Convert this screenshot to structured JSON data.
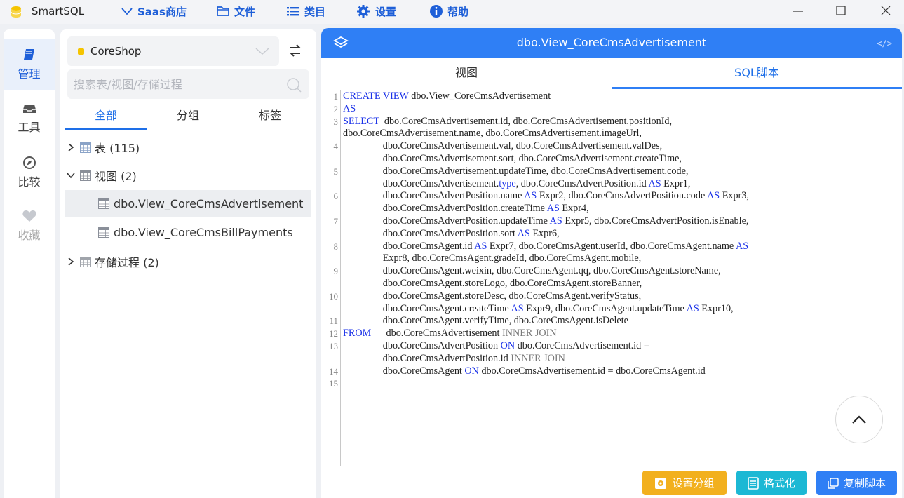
{
  "app": {
    "title": "SmartSQL"
  },
  "menu": [
    {
      "label": "Saas商店",
      "icon": "chevron-down-icon"
    },
    {
      "label": "文件",
      "icon": "folder-icon"
    },
    {
      "label": "类目",
      "icon": "list-icon"
    },
    {
      "label": "设置",
      "icon": "gear-icon"
    },
    {
      "label": "帮助",
      "icon": "info-icon"
    }
  ],
  "rail": [
    {
      "label": "管理",
      "icon": "book-icon",
      "active": true
    },
    {
      "label": "工具",
      "icon": "inbox-icon"
    },
    {
      "label": "比较",
      "icon": "compass-icon"
    },
    {
      "label": "收藏",
      "icon": "heart-icon"
    }
  ],
  "db": {
    "name": "CoreShop"
  },
  "search": {
    "placeholder": "搜索表/视图/存储过程"
  },
  "tree_tabs": [
    "全部",
    "分组",
    "标签"
  ],
  "tree": {
    "tables": "表 (115)",
    "views": "视图 (2)",
    "view_items": [
      "dbo.View_CoreCmsAdvertisement",
      "dbo.View_CoreCmsBillPayments"
    ],
    "procs": "存储过程 (2)"
  },
  "editor": {
    "title": "dbo.View_CoreCmsAdvertisement",
    "code_toggle": "</>",
    "tabs": [
      "视图",
      "SQL脚本"
    ],
    "active_tab": "SQL脚本",
    "lines": [
      {
        "n": "1",
        "t": [
          [
            "kw",
            "CREATE VIEW"
          ],
          [
            "",
            "dbo.View_CoreCmsAdvertisement"
          ]
        ]
      },
      {
        "n": "2",
        "t": [
          [
            "kw",
            "AS"
          ]
        ]
      },
      {
        "n": "3",
        "t": [
          [
            "kw",
            "SELECT"
          ],
          [
            "",
            "  dbo.CoreCmsAdvertisement.id, dbo.CoreCmsAdvertisement.positionId,"
          ]
        ]
      },
      {
        "n": "",
        "t": [
          [
            "",
            "dbo.CoreCmsAdvertisement.name, dbo.CoreCmsAdvertisement.imageUrl,"
          ]
        ]
      },
      {
        "n": "4",
        "t": [
          [
            "",
            "                dbo.CoreCmsAdvertisement.val, dbo.CoreCmsAdvertisement.valDes,"
          ]
        ]
      },
      {
        "n": "",
        "t": [
          [
            "",
            "                dbo.CoreCmsAdvertisement.sort, dbo.CoreCmsAdvertisement.createTime,"
          ]
        ]
      },
      {
        "n": "5",
        "t": [
          [
            "",
            "                dbo.CoreCmsAdvertisement.updateTime, dbo.CoreCmsAdvertisement.code,"
          ]
        ]
      },
      {
        "n": "",
        "t": [
          [
            "",
            "                dbo.CoreCmsAdvertisement."
          ],
          [
            "kw",
            "type"
          ],
          [
            "",
            ", dbo.CoreCmsAdvertPosition.id "
          ],
          [
            "kw",
            "AS"
          ],
          [
            "",
            " Expr1,"
          ]
        ]
      },
      {
        "n": "6",
        "t": [
          [
            "",
            "                dbo.CoreCmsAdvertPosition.name "
          ],
          [
            "kw",
            "AS"
          ],
          [
            "",
            " Expr2, dbo.CoreCmsAdvertPosition.code "
          ],
          [
            "kw",
            "AS"
          ],
          [
            "",
            " Expr3,"
          ]
        ]
      },
      {
        "n": "",
        "t": [
          [
            "",
            "                dbo.CoreCmsAdvertPosition.createTime "
          ],
          [
            "kw",
            "AS"
          ],
          [
            "",
            " Expr4,"
          ]
        ]
      },
      {
        "n": "7",
        "t": [
          [
            "",
            "                dbo.CoreCmsAdvertPosition.updateTime "
          ],
          [
            "kw",
            "AS"
          ],
          [
            "",
            " Expr5, dbo.CoreCmsAdvertPosition.isEnable,"
          ]
        ]
      },
      {
        "n": "",
        "t": [
          [
            "",
            "                dbo.CoreCmsAdvertPosition.sort "
          ],
          [
            "kw",
            "AS"
          ],
          [
            "",
            " Expr6,"
          ]
        ]
      },
      {
        "n": "8",
        "t": [
          [
            "",
            "                dbo.CoreCmsAgent.id "
          ],
          [
            "kw",
            "AS"
          ],
          [
            "",
            " Expr7, dbo.CoreCmsAgent.userId, dbo.CoreCmsAgent.name "
          ],
          [
            "kw",
            "AS"
          ]
        ]
      },
      {
        "n": "",
        "t": [
          [
            "",
            "                Expr8, dbo.CoreCmsAgent.gradeId, dbo.CoreCmsAgent.mobile,"
          ]
        ]
      },
      {
        "n": "9",
        "t": [
          [
            "",
            "                dbo.CoreCmsAgent.weixin, dbo.CoreCmsAgent.qq, dbo.CoreCmsAgent.storeName,"
          ]
        ]
      },
      {
        "n": "",
        "t": [
          [
            "",
            "                dbo.CoreCmsAgent.storeLogo, dbo.CoreCmsAgent.storeBanner,"
          ]
        ]
      },
      {
        "n": "10",
        "t": [
          [
            "",
            "                dbo.CoreCmsAgent.storeDesc, dbo.CoreCmsAgent.verifyStatus,"
          ]
        ]
      },
      {
        "n": "",
        "t": [
          [
            "",
            "                dbo.CoreCmsAgent.createTime "
          ],
          [
            "kw",
            "AS"
          ],
          [
            "",
            " Expr9, dbo.CoreCmsAgent.updateTime "
          ],
          [
            "kw",
            "AS"
          ],
          [
            "",
            " Expr10,"
          ]
        ]
      },
      {
        "n": "11",
        "t": [
          [
            "",
            "                dbo.CoreCmsAgent.verifyTime, dbo.CoreCmsAgent.isDelete"
          ]
        ]
      },
      {
        "n": "12",
        "t": [
          [
            "kw",
            "FROM"
          ],
          [
            "",
            "      dbo.CoreCmsAdvertisement "
          ],
          [
            "kw2",
            "INNER JOIN"
          ]
        ]
      },
      {
        "n": "13",
        "t": [
          [
            "",
            "                dbo.CoreCmsAdvertPosition "
          ],
          [
            "kw",
            "ON"
          ],
          [
            "",
            " dbo.CoreCmsAdvertisement.id ="
          ]
        ]
      },
      {
        "n": "",
        "t": [
          [
            "",
            "                dbo.CoreCmsAdvertPosition.id "
          ],
          [
            "kw2",
            "INNER JOIN"
          ]
        ]
      },
      {
        "n": "14",
        "t": [
          [
            "",
            "                dbo.CoreCmsAgent "
          ],
          [
            "kw",
            "ON"
          ],
          [
            "",
            " dbo.CoreCmsAdvertisement.id = dbo.CoreCmsAgent.id"
          ]
        ]
      },
      {
        "n": "15",
        "t": []
      }
    ]
  },
  "actions": [
    {
      "label": "设置分组",
      "color": "#f2b01e",
      "icon": "group-settings-icon"
    },
    {
      "label": "格式化",
      "color": "#1cb8d4",
      "icon": "format-icon"
    },
    {
      "label": "复制脚本",
      "color": "#2f7ff5",
      "icon": "copy-icon"
    }
  ],
  "colors": {
    "accent": "#2f7ff5",
    "brand_menu": "#1e5fd8"
  }
}
